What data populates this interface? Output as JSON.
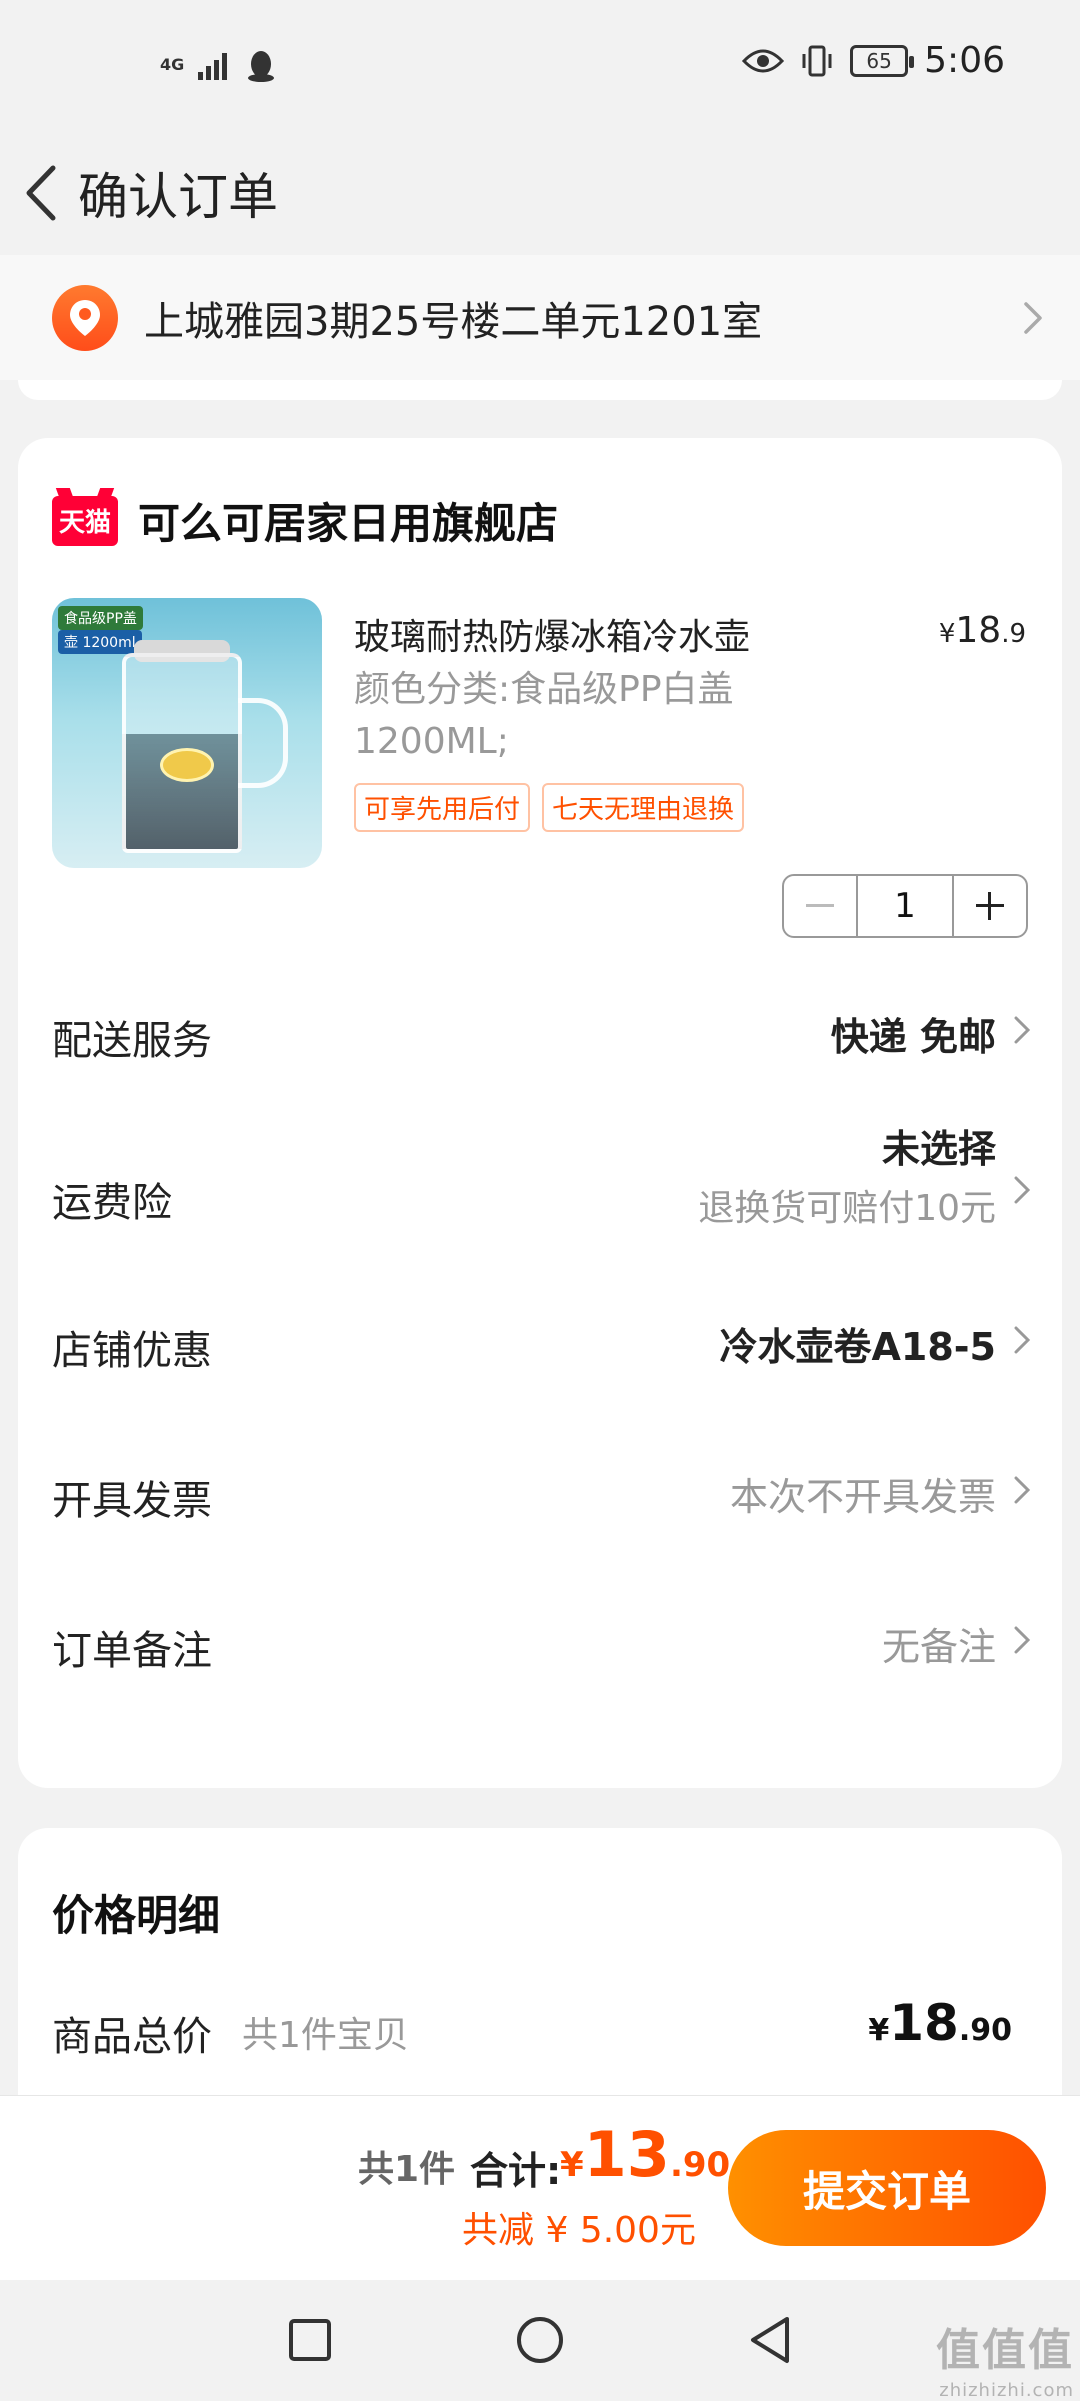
{
  "status_bar": {
    "network": "4G",
    "battery": "65",
    "time": "5:06"
  },
  "header": {
    "title": "确认订单"
  },
  "address": {
    "text": "上城雅园3期25号楼二单元1201室"
  },
  "store": {
    "badge": "天猫",
    "name": "可么可居家日用旗舰店",
    "product": {
      "image_tag_1": "食品级PP盖",
      "image_tag_2": "壶 1200ml",
      "title": "玻璃耐热防爆冰箱冷水壶",
      "price_currency": "¥",
      "price_int": "18",
      "price_dec": ".9",
      "spec": "颜色分类:食品级PP白盖 1200ML;",
      "tags": [
        "可享先用后付",
        "七天无理由退换"
      ],
      "quantity": "1"
    },
    "options": [
      {
        "label": "配送服务",
        "value": "快递 免邮",
        "sub": ""
      },
      {
        "label": "运费险",
        "value": "未选择",
        "sub": "退换货可赔付10元"
      },
      {
        "label": "店铺优惠",
        "value": "冷水壶卷A18-5",
        "sub": ""
      },
      {
        "label": "开具发票",
        "value": "本次不开具发票",
        "sub": ""
      },
      {
        "label": "订单备注",
        "value": "无备注",
        "sub": ""
      }
    ]
  },
  "price_detail": {
    "title": "价格明细",
    "row_label": "商品总价",
    "row_sub": "共1件宝贝",
    "row_currency": "¥",
    "row_int": "18",
    "row_dec": ".90"
  },
  "bottom_bar": {
    "count": "共1件",
    "total_label": "合计:",
    "total_currency": "¥",
    "total_int": "13",
    "total_dec": ".90",
    "saved": "共减 ¥ 5.00元",
    "submit": "提交订单"
  },
  "watermark": {
    "main": "值值值",
    "sub": "zhizhizhi.com"
  },
  "colors": {
    "accent": "#ff5000",
    "tmall": "#ff0036",
    "background": "#f2f2f2"
  }
}
